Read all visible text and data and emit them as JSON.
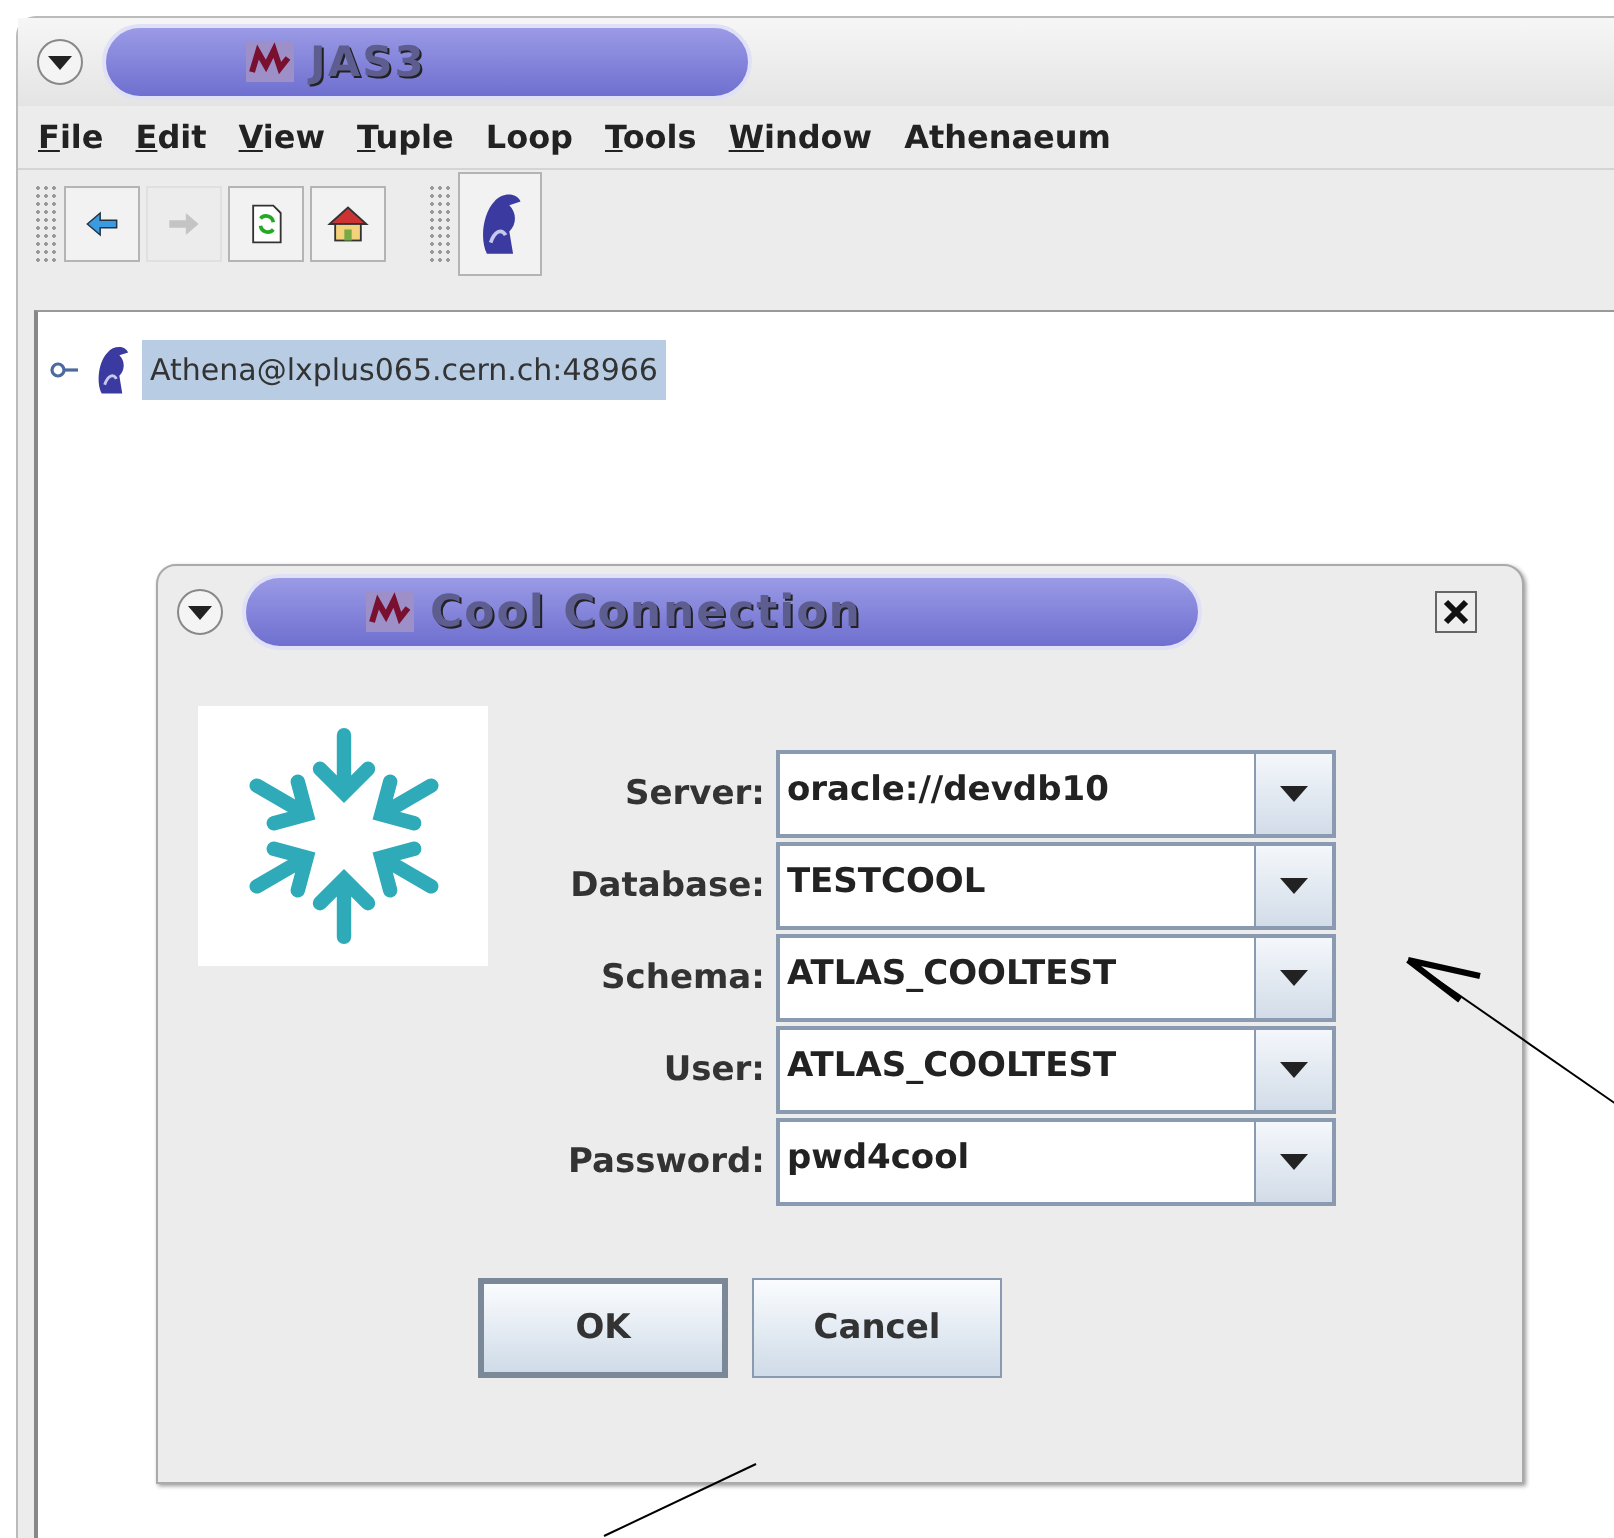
{
  "window": {
    "title": "JAS3"
  },
  "menu": [
    {
      "label": "File",
      "mnemonic": true
    },
    {
      "label": "Edit",
      "mnemonic": true
    },
    {
      "label": "View",
      "mnemonic": true
    },
    {
      "label": "Tuple",
      "mnemonic": true
    },
    {
      "label": "Loop",
      "mnemonic": false
    },
    {
      "label": "Tools",
      "mnemonic": true
    },
    {
      "label": "Window",
      "mnemonic": true
    },
    {
      "label": "Athenaeum",
      "mnemonic": false
    }
  ],
  "toolbar": [
    {
      "kind": "back",
      "disabled": false
    },
    {
      "kind": "forward",
      "disabled": true
    },
    {
      "kind": "refresh",
      "disabled": false
    },
    {
      "kind": "home",
      "disabled": false
    }
  ],
  "tree": [
    {
      "label": "Athena@lxplus065.cern.ch:48966",
      "selected": true
    }
  ],
  "dialog": {
    "title": "Cool Connection",
    "fields": [
      {
        "label": "Server:",
        "value": "oracle://devdb10"
      },
      {
        "label": "Database:",
        "value": "TESTCOOL"
      },
      {
        "label": "Schema:",
        "value": "ATLAS_COOLTEST"
      },
      {
        "label": "User:",
        "value": "ATLAS_COOLTEST"
      },
      {
        "label": "Password:",
        "value": "pwd4cool"
      }
    ],
    "buttons": [
      {
        "label": "OK",
        "default": true
      },
      {
        "label": "Cancel",
        "default": false
      }
    ]
  }
}
